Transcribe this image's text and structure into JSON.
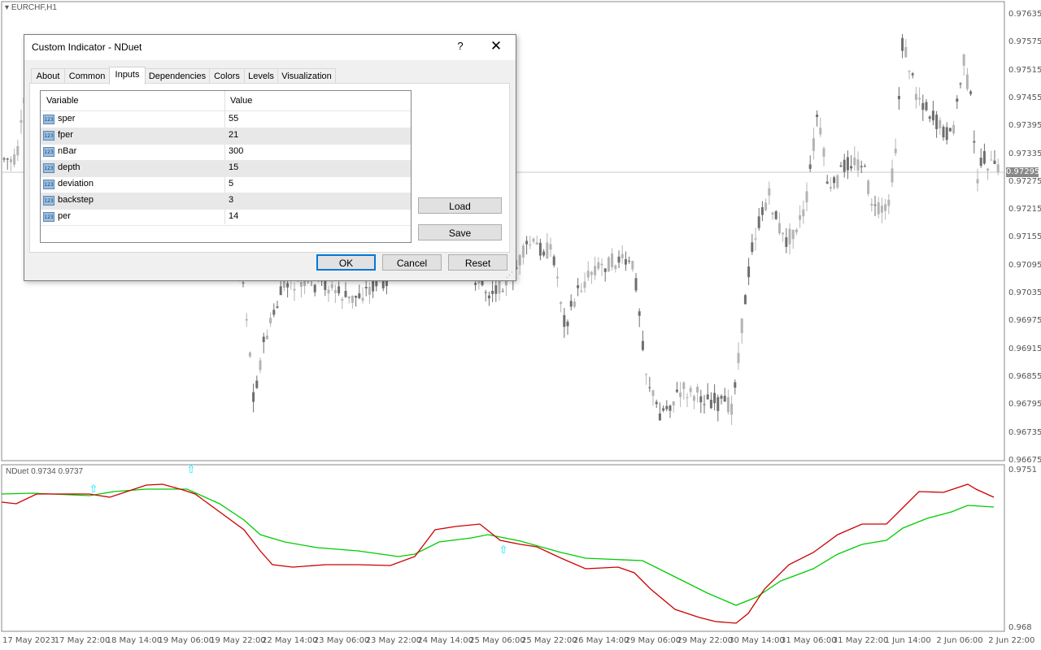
{
  "chart": {
    "symbol_label": "EURCHF,H1",
    "current_price": "0.97295",
    "price_axis": [
      "0.97635",
      "0.97575",
      "0.97515",
      "0.97455",
      "0.97395",
      "0.97335",
      "0.97275",
      "0.97215",
      "0.97155",
      "0.97095",
      "0.97035",
      "0.96975",
      "0.96915",
      "0.96855",
      "0.96795",
      "0.96735",
      "0.96675"
    ],
    "indicator_label": "NDuet 0.9734 0.9737",
    "indicator_axis": [
      "0.9751",
      "0.968"
    ],
    "time_axis": [
      "17 May 2023",
      "17 May 22:00",
      "18 May 14:00",
      "19 May 06:00",
      "19 May 22:00",
      "22 May 14:00",
      "23 May 06:00",
      "23 May 22:00",
      "24 May 14:00",
      "25 May 06:00",
      "25 May 22:00",
      "26 May 14:00",
      "29 May 06:00",
      "29 May 22:00",
      "30 May 14:00",
      "31 May 06:00",
      "31 May 22:00",
      "1 Jun 14:00",
      "2 Jun 06:00",
      "2 Jun 22:00"
    ],
    "colors": {
      "candle": "#6e6e6e",
      "candle_light": "#b4b4b4",
      "fast_line": "#cc0000",
      "slow_line": "#00cc00",
      "arrow": "#00e5ff"
    }
  },
  "dialog": {
    "title": "Custom Indicator - NDuet",
    "help_label": "?",
    "close_label": "✕",
    "tabs": [
      {
        "label": "About",
        "active": false
      },
      {
        "label": "Common",
        "active": false
      },
      {
        "label": "Inputs",
        "active": true
      },
      {
        "label": "Dependencies",
        "active": false
      },
      {
        "label": "Colors",
        "active": false
      },
      {
        "label": "Levels",
        "active": false
      },
      {
        "label": "Visualization",
        "active": false
      }
    ],
    "table": {
      "col_variable": "Variable",
      "col_value": "Value",
      "icon_text": "123",
      "rows": [
        {
          "variable": "sper",
          "value": "55"
        },
        {
          "variable": "fper",
          "value": "21"
        },
        {
          "variable": "nBar",
          "value": "300"
        },
        {
          "variable": "depth",
          "value": "15"
        },
        {
          "variable": "deviation",
          "value": "5"
        },
        {
          "variable": "backstep",
          "value": "3"
        },
        {
          "variable": "per",
          "value": "14"
        }
      ]
    },
    "load_label": "Load",
    "save_label": "Save",
    "ok_label": "OK",
    "cancel_label": "Cancel",
    "reset_label": "Reset"
  }
}
